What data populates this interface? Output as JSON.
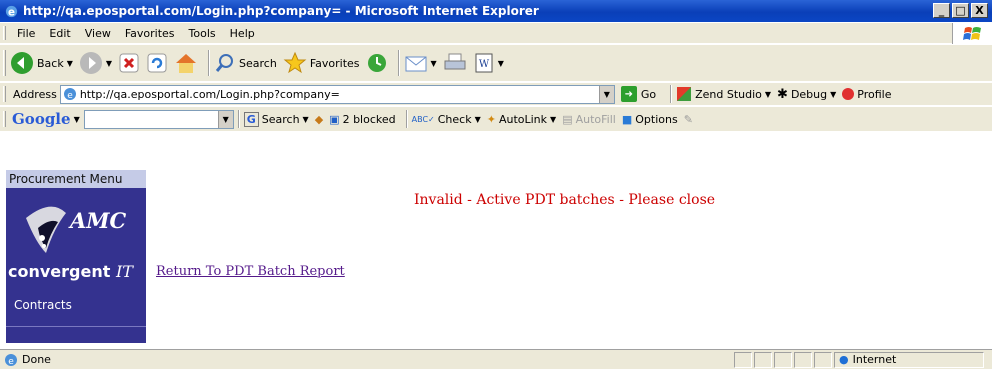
{
  "window": {
    "title": "http://qa.eposportal.com/Login.php?company= - Microsoft Internet Explorer",
    "minimize_label": "_",
    "maximize_label": "□",
    "close_label": "X"
  },
  "menu": {
    "items": [
      "File",
      "Edit",
      "View",
      "Favorites",
      "Tools",
      "Help"
    ]
  },
  "toolbar": {
    "back_label": "Back",
    "search_label": "Search",
    "favorites_label": "Favorites"
  },
  "address": {
    "label": "Address",
    "url": "http://qa.eposportal.com/Login.php?company=",
    "go_label": "Go",
    "zend_label": "Zend Studio",
    "debug_label": "Debug",
    "profile_label": "Profile"
  },
  "google": {
    "logo": "Google",
    "search_label": "Search",
    "blocked_label": "2 blocked",
    "check_label": "Check",
    "autolink_label": "AutoLink",
    "autofill_label": "AutoFill",
    "options_label": "Options"
  },
  "sidebar": {
    "menu_title": "Procurement Menu",
    "logo_amc": "AMC",
    "logo_convergent": "convergent",
    "logo_it": "IT",
    "items": [
      "Contracts"
    ]
  },
  "main": {
    "message": "Invalid - Active PDT batches - Please close",
    "return_link": "Return To PDT Batch Report"
  },
  "status": {
    "text": "Done",
    "zone": "Internet"
  },
  "colors": {
    "titlebar": "#0a3fb8",
    "sidebar": "#34328f",
    "message": "#cc0000",
    "link": "#551a8b"
  }
}
